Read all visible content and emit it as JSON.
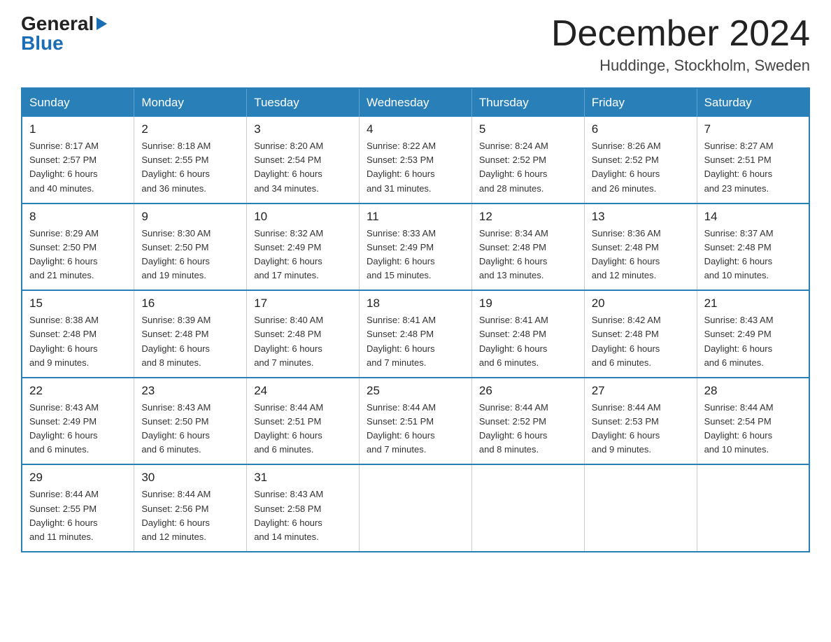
{
  "header": {
    "logo_line1": "General",
    "logo_line2": "Blue",
    "month": "December 2024",
    "location": "Huddinge, Stockholm, Sweden"
  },
  "days_of_week": [
    "Sunday",
    "Monday",
    "Tuesday",
    "Wednesday",
    "Thursday",
    "Friday",
    "Saturday"
  ],
  "weeks": [
    [
      {
        "day": "1",
        "sunrise": "8:17 AM",
        "sunset": "2:57 PM",
        "daylight": "6 hours and 40 minutes."
      },
      {
        "day": "2",
        "sunrise": "8:18 AM",
        "sunset": "2:55 PM",
        "daylight": "6 hours and 36 minutes."
      },
      {
        "day": "3",
        "sunrise": "8:20 AM",
        "sunset": "2:54 PM",
        "daylight": "6 hours and 34 minutes."
      },
      {
        "day": "4",
        "sunrise": "8:22 AM",
        "sunset": "2:53 PM",
        "daylight": "6 hours and 31 minutes."
      },
      {
        "day": "5",
        "sunrise": "8:24 AM",
        "sunset": "2:52 PM",
        "daylight": "6 hours and 28 minutes."
      },
      {
        "day": "6",
        "sunrise": "8:26 AM",
        "sunset": "2:52 PM",
        "daylight": "6 hours and 26 minutes."
      },
      {
        "day": "7",
        "sunrise": "8:27 AM",
        "sunset": "2:51 PM",
        "daylight": "6 hours and 23 minutes."
      }
    ],
    [
      {
        "day": "8",
        "sunrise": "8:29 AM",
        "sunset": "2:50 PM",
        "daylight": "6 hours and 21 minutes."
      },
      {
        "day": "9",
        "sunrise": "8:30 AM",
        "sunset": "2:50 PM",
        "daylight": "6 hours and 19 minutes."
      },
      {
        "day": "10",
        "sunrise": "8:32 AM",
        "sunset": "2:49 PM",
        "daylight": "6 hours and 17 minutes."
      },
      {
        "day": "11",
        "sunrise": "8:33 AM",
        "sunset": "2:49 PM",
        "daylight": "6 hours and 15 minutes."
      },
      {
        "day": "12",
        "sunrise": "8:34 AM",
        "sunset": "2:48 PM",
        "daylight": "6 hours and 13 minutes."
      },
      {
        "day": "13",
        "sunrise": "8:36 AM",
        "sunset": "2:48 PM",
        "daylight": "6 hours and 12 minutes."
      },
      {
        "day": "14",
        "sunrise": "8:37 AM",
        "sunset": "2:48 PM",
        "daylight": "6 hours and 10 minutes."
      }
    ],
    [
      {
        "day": "15",
        "sunrise": "8:38 AM",
        "sunset": "2:48 PM",
        "daylight": "6 hours and 9 minutes."
      },
      {
        "day": "16",
        "sunrise": "8:39 AM",
        "sunset": "2:48 PM",
        "daylight": "6 hours and 8 minutes."
      },
      {
        "day": "17",
        "sunrise": "8:40 AM",
        "sunset": "2:48 PM",
        "daylight": "6 hours and 7 minutes."
      },
      {
        "day": "18",
        "sunrise": "8:41 AM",
        "sunset": "2:48 PM",
        "daylight": "6 hours and 7 minutes."
      },
      {
        "day": "19",
        "sunrise": "8:41 AM",
        "sunset": "2:48 PM",
        "daylight": "6 hours and 6 minutes."
      },
      {
        "day": "20",
        "sunrise": "8:42 AM",
        "sunset": "2:48 PM",
        "daylight": "6 hours and 6 minutes."
      },
      {
        "day": "21",
        "sunrise": "8:43 AM",
        "sunset": "2:49 PM",
        "daylight": "6 hours and 6 minutes."
      }
    ],
    [
      {
        "day": "22",
        "sunrise": "8:43 AM",
        "sunset": "2:49 PM",
        "daylight": "6 hours and 6 minutes."
      },
      {
        "day": "23",
        "sunrise": "8:43 AM",
        "sunset": "2:50 PM",
        "daylight": "6 hours and 6 minutes."
      },
      {
        "day": "24",
        "sunrise": "8:44 AM",
        "sunset": "2:51 PM",
        "daylight": "6 hours and 6 minutes."
      },
      {
        "day": "25",
        "sunrise": "8:44 AM",
        "sunset": "2:51 PM",
        "daylight": "6 hours and 7 minutes."
      },
      {
        "day": "26",
        "sunrise": "8:44 AM",
        "sunset": "2:52 PM",
        "daylight": "6 hours and 8 minutes."
      },
      {
        "day": "27",
        "sunrise": "8:44 AM",
        "sunset": "2:53 PM",
        "daylight": "6 hours and 9 minutes."
      },
      {
        "day": "28",
        "sunrise": "8:44 AM",
        "sunset": "2:54 PM",
        "daylight": "6 hours and 10 minutes."
      }
    ],
    [
      {
        "day": "29",
        "sunrise": "8:44 AM",
        "sunset": "2:55 PM",
        "daylight": "6 hours and 11 minutes."
      },
      {
        "day": "30",
        "sunrise": "8:44 AM",
        "sunset": "2:56 PM",
        "daylight": "6 hours and 12 minutes."
      },
      {
        "day": "31",
        "sunrise": "8:43 AM",
        "sunset": "2:58 PM",
        "daylight": "6 hours and 14 minutes."
      },
      null,
      null,
      null,
      null
    ]
  ],
  "labels": {
    "sunrise": "Sunrise:",
    "sunset": "Sunset:",
    "daylight": "Daylight:"
  }
}
